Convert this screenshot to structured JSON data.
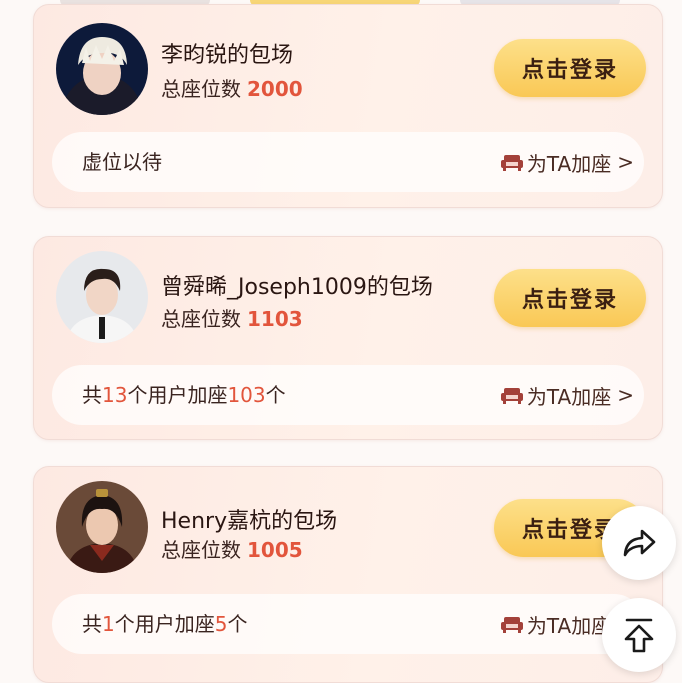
{
  "cards": [
    {
      "title": "李昀锐的包场",
      "seats_label": "总座位数",
      "seats_value": "2000",
      "login_label": "点击登录",
      "status_text": "虚位以待",
      "add_seat_label": "为TA加座",
      "chevron": ">"
    },
    {
      "title": "曾舜晞_Joseph1009的包场",
      "seats_label": "总座位数",
      "seats_value": "1103",
      "login_label": "点击登录",
      "status": {
        "prefix": "共",
        "users": "13",
        "mid": "个用户加座",
        "count": "103",
        "suffix": "个"
      },
      "add_seat_label": "为TA加座",
      "chevron": ">"
    },
    {
      "title": "Henry嘉杭的包场",
      "seats_label": "总座位数",
      "seats_value": "1005",
      "login_label": "点击登录",
      "status": {
        "prefix": "共",
        "users": "1",
        "mid": "个用户加座",
        "count": "5",
        "suffix": "个"
      },
      "add_seat_label": "为TA加座",
      "chevron": ">"
    }
  ],
  "floating": {
    "share_icon": "share-icon",
    "top_icon": "back-to-top-icon"
  },
  "colors": {
    "accent": "#e2553c",
    "button": "#f9c855",
    "card_bg": "#fde9e2"
  }
}
